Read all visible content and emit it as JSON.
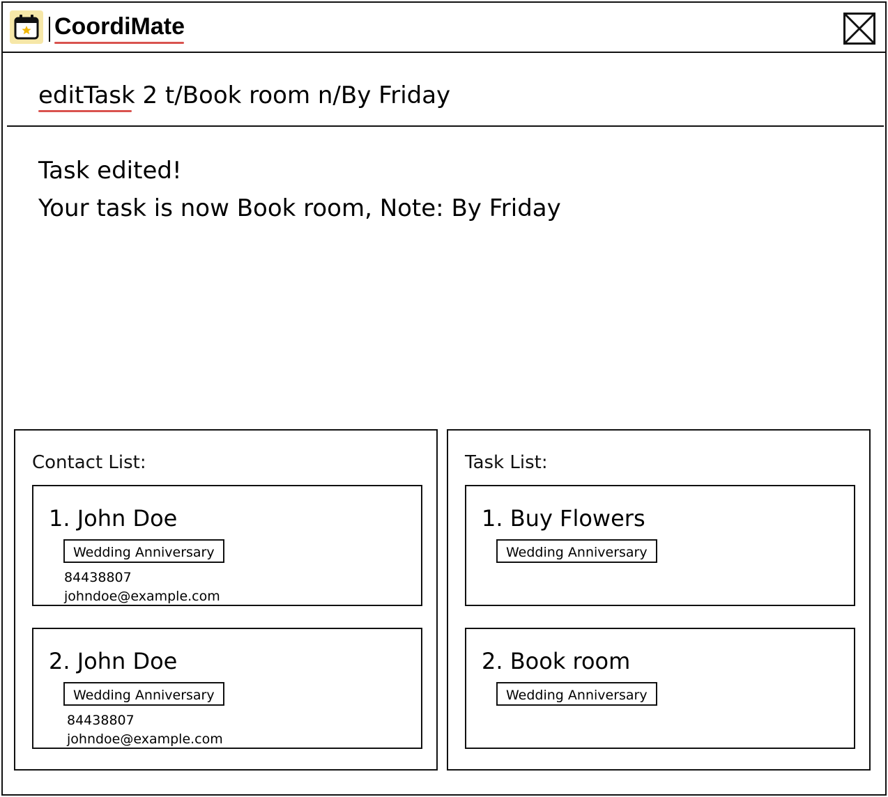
{
  "window": {
    "title": "CoordiMate",
    "icon": "calendar-star-icon",
    "close_icon": "close-icon"
  },
  "colors": {
    "accent_underline": "#d9534f",
    "icon_background": "#f6e7a8",
    "icon_star": "#f2b705"
  },
  "command": {
    "value": "editTask 2 t/Book room n/By Friday"
  },
  "result": {
    "lines": [
      "Task edited!",
      "Your task is now Book room, Note: By Friday"
    ]
  },
  "contact_list": {
    "title": "Contact List:",
    "items": [
      {
        "name": "1. John Doe",
        "tag": "Wedding Anniversary",
        "phone": "84438807",
        "email": "johndoe@example.com"
      },
      {
        "name": "2. John Doe",
        "tag": "Wedding Anniversary",
        "phone": "84438807",
        "email": "johndoe@example.com"
      }
    ]
  },
  "task_list": {
    "title": "Task List:",
    "items": [
      {
        "name": "1. Buy Flowers",
        "tag": "Wedding Anniversary"
      },
      {
        "name": "2. Book room",
        "tag": "Wedding Anniversary"
      }
    ]
  }
}
